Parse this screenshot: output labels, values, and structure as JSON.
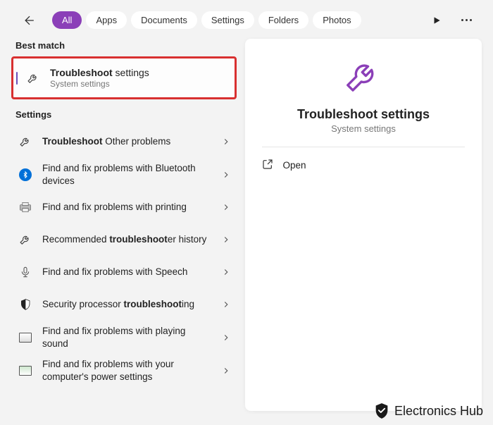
{
  "tabs": {
    "all": "All",
    "apps": "Apps",
    "documents": "Documents",
    "settings": "Settings",
    "folders": "Folders",
    "photos": "Photos"
  },
  "sections": {
    "bestMatch": "Best match",
    "settings": "Settings"
  },
  "bestMatch": {
    "titleBold": "Troubleshoot",
    "titleRest": " settings",
    "sub": "System settings"
  },
  "results": {
    "r1": {
      "bold": "Troubleshoot",
      "rest": " Other problems"
    },
    "r2": {
      "text": "Find and fix problems with Bluetooth devices"
    },
    "r3": {
      "text": "Find and fix problems with printing"
    },
    "r4": {
      "pre": "Recommended ",
      "bold": "troubleshoot",
      "post": "er history"
    },
    "r5": {
      "text": "Find and fix problems with Speech"
    },
    "r6": {
      "pre": "Security processor ",
      "bold": "troubleshoot",
      "post": "ing"
    },
    "r7": {
      "text": "Find and fix problems with playing sound"
    },
    "r8": {
      "text": "Find and fix problems with your computer's power settings"
    }
  },
  "detail": {
    "title": "Troubleshoot settings",
    "sub": "System settings",
    "open": "Open"
  },
  "watermark": "Electronics Hub",
  "colors": {
    "accent": "#8b3fb8",
    "highlight": "#d83030"
  }
}
